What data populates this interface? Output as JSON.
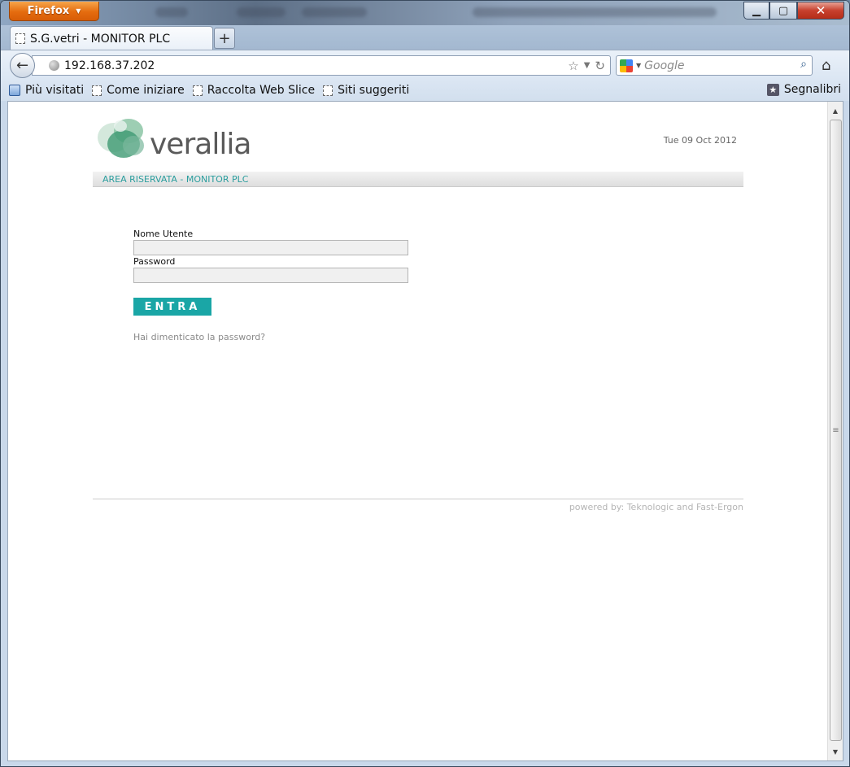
{
  "browser": {
    "menu_button": "Firefox",
    "tab_title": "S.G.vetri - MONITOR PLC",
    "url": "192.168.37.202",
    "search_placeholder": "Google",
    "bookmarks": [
      "Più visitati",
      "Come iniziare",
      "Raccolta Web Slice",
      "Siti suggeriti"
    ],
    "bookmarks_menu": "Segnalibri"
  },
  "page": {
    "logo_text": "verallia",
    "date": "Tue 09 Oct 2012",
    "area_title": "AREA RISERVATA - MONITOR PLC",
    "form": {
      "username_label": "Nome Utente",
      "username_value": "",
      "password_label": "Password",
      "password_value": "",
      "submit_label": "ENTRA",
      "forgot_link": "Hai dimenticato la password?"
    },
    "footer": "powered by: Teknologic and Fast-Ergon"
  },
  "colors": {
    "accent": "#1aa6a6",
    "firefox_orange": "#e56c0f"
  }
}
